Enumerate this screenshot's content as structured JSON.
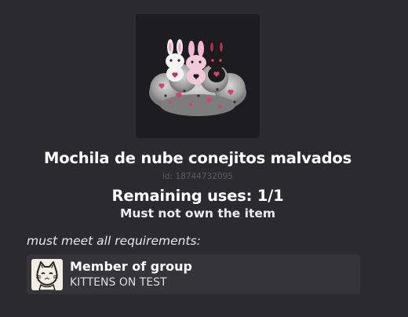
{
  "item": {
    "name": "Mochila de nube conejitos malvados",
    "id_text": "id: 18744732095",
    "image_icon": "bunny-cloud-backpack-thumbnail"
  },
  "status": {
    "remaining_uses": "Remaining uses: 1/1",
    "ownership_note": "Must not own the item"
  },
  "requirements": {
    "heading": "must meet all requirements:",
    "items": [
      {
        "type": "Member of group",
        "value": "KITTENS ON TEST",
        "icon": "cat-group-icon"
      }
    ]
  },
  "colors": {
    "background": "#2b2a31",
    "card": "#35343b",
    "id_text": "#5c5b63"
  }
}
